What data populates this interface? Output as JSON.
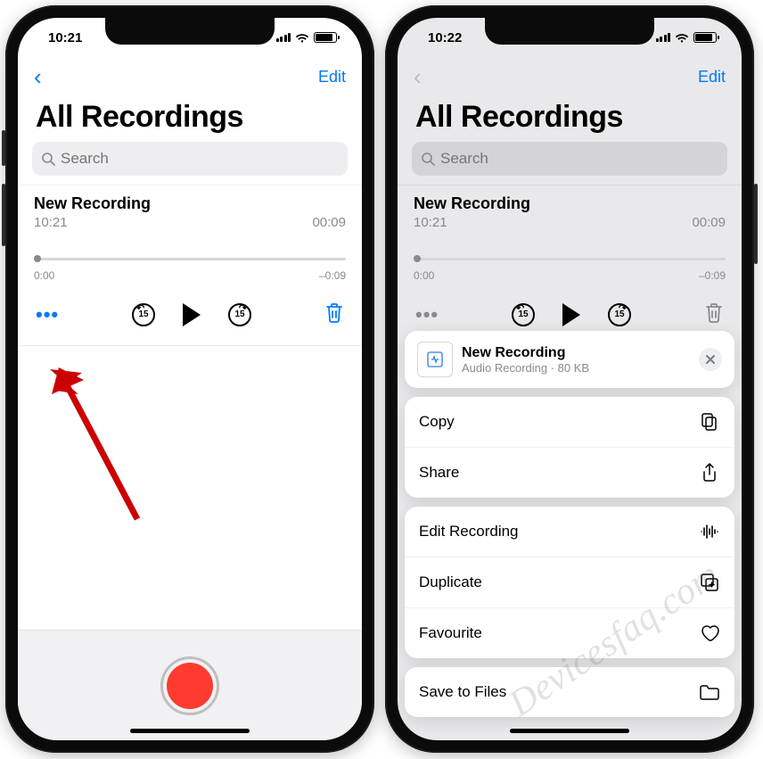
{
  "left": {
    "status_time": "10:21",
    "back_glyph": "‹",
    "edit_label": "Edit",
    "title": "All Recordings",
    "search_placeholder": "Search",
    "rec_title": "New Recording",
    "rec_time": "10:21",
    "rec_duration": "00:09",
    "scrub_start": "0:00",
    "scrub_end": "–0:09",
    "seek_amount": "15"
  },
  "right": {
    "status_time": "10:22",
    "back_glyph": "‹",
    "edit_label": "Edit",
    "title": "All Recordings",
    "search_placeholder": "Search",
    "rec_title": "New Recording",
    "rec_time": "10:21",
    "rec_duration": "00:09",
    "scrub_start": "0:00",
    "scrub_end": "–0:09",
    "seek_amount": "15",
    "sheet": {
      "file_title": "New Recording",
      "file_meta": "Audio Recording · 80 KB",
      "group1": {
        "copy": "Copy",
        "share": "Share"
      },
      "group2": {
        "edit": "Edit Recording",
        "duplicate": "Duplicate",
        "favourite": "Favourite"
      },
      "group3": {
        "save": "Save to Files"
      }
    }
  },
  "watermark": "Devicesfaq.com"
}
